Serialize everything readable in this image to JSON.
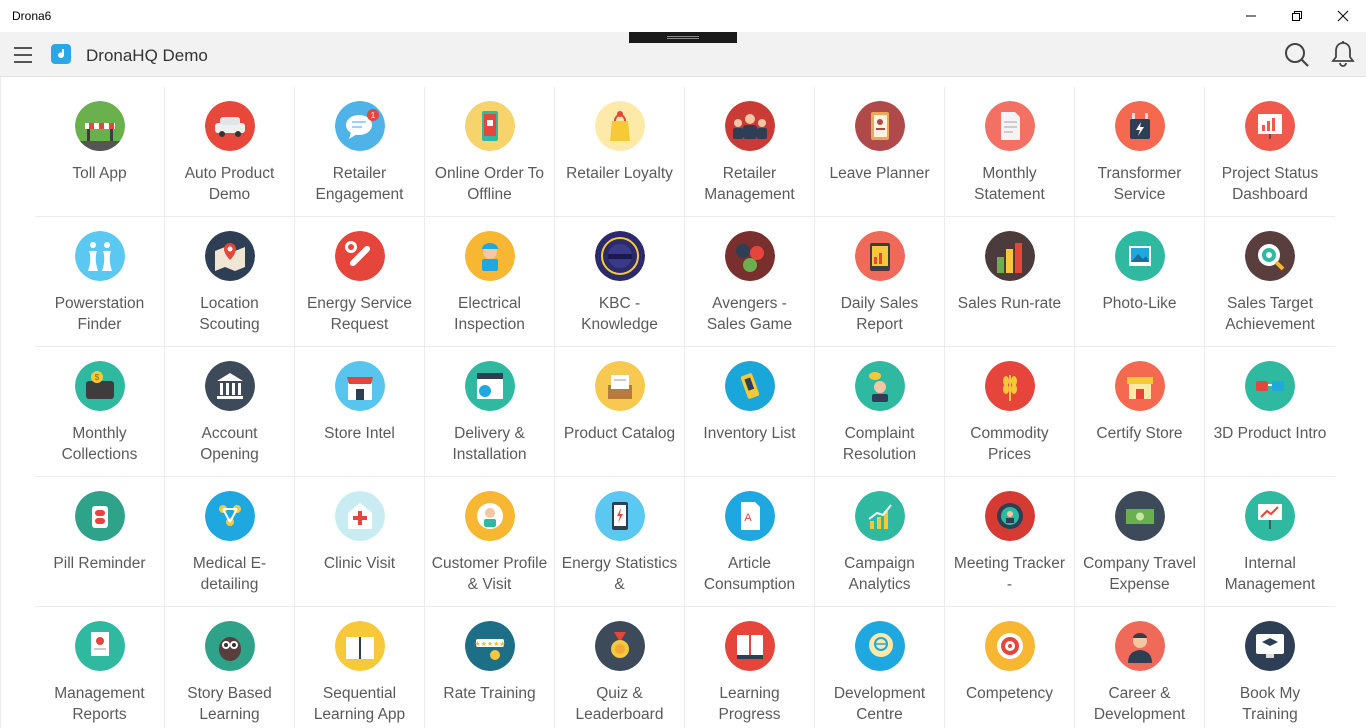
{
  "window": {
    "title": "Drona6",
    "buttons": {
      "minimize": "minimize",
      "maximize": "maximize",
      "close": "close"
    }
  },
  "appbar": {
    "title": "DronaHQ Demo",
    "brand_color": "#29a7e8",
    "icons": [
      "hamburger-menu-icon",
      "app-logo-icon",
      "search-icon",
      "bell-icon"
    ]
  },
  "apps": [
    {
      "label": "Toll App",
      "bg": "#6ab04c",
      "icon": "toll-barrier-icon"
    },
    {
      "label": "Auto Product Demo",
      "bg": "#e8473b",
      "icon": "car-icon"
    },
    {
      "label": "Retailer Engagement",
      "bg": "#4fb3e8",
      "icon": "chat-bubble-icon"
    },
    {
      "label": "Online Order To Offline",
      "bg": "#f6d36b",
      "icon": "mobile-cart-icon"
    },
    {
      "label": "Retailer Loyalty",
      "bg": "#fde9a8",
      "icon": "shopping-bag-icon"
    },
    {
      "label": "Retailer Management",
      "bg": "#c93b34",
      "icon": "people-group-icon"
    },
    {
      "label": "Leave Planner",
      "bg": "#b04a4a",
      "icon": "notebook-icon"
    },
    {
      "label": "Monthly Statement",
      "bg": "#f27164",
      "icon": "document-icon"
    },
    {
      "label": "Transformer Service",
      "bg": "#f4694f",
      "icon": "transformer-icon"
    },
    {
      "label": "Project Status Dashboard",
      "bg": "#ef5a4d",
      "icon": "dashboard-chart-icon"
    },
    {
      "label": "Powerstation Finder",
      "bg": "#5ac8f0",
      "icon": "cooling-tower-icon"
    },
    {
      "label": "Location Scouting",
      "bg": "#2e3e55",
      "icon": "map-pin-icon"
    },
    {
      "label": "Energy Service Request",
      "bg": "#e5453a",
      "icon": "wrench-icon"
    },
    {
      "label": "Electrical Inspection",
      "bg": "#f7b733",
      "icon": "worker-icon"
    },
    {
      "label": "KBC - Knowledge",
      "bg": "#2b2a6a",
      "icon": "kbc-logo-icon"
    },
    {
      "label": "Avengers - Sales Game",
      "bg": "#7a2f2f",
      "icon": "avengers-icon"
    },
    {
      "label": "Daily Sales Report",
      "bg": "#f06a5a",
      "icon": "tablet-chart-icon"
    },
    {
      "label": "Sales Run-rate",
      "bg": "#4b3b3b",
      "icon": "bar-columns-icon"
    },
    {
      "label": "Photo-Like",
      "bg": "#2fb9a0",
      "icon": "photo-icon"
    },
    {
      "label": "Sales Target Achievement",
      "bg": "#5a3d3d",
      "icon": "target-magnifier-icon"
    },
    {
      "label": "Monthly Collections",
      "bg": "#2fb9a0",
      "icon": "wallet-coins-icon"
    },
    {
      "label": "Account Opening",
      "bg": "#3d4a5a",
      "icon": "bank-icon"
    },
    {
      "label": "Store Intel",
      "bg": "#58c5ee",
      "icon": "storefront-icon"
    },
    {
      "label": "Delivery & Installation",
      "bg": "#2fb9a0",
      "icon": "calendar-grid-icon"
    },
    {
      "label": "Product Catalog",
      "bg": "#f7c950",
      "icon": "catalog-box-icon"
    },
    {
      "label": "Inventory List",
      "bg": "#1aa6d8",
      "icon": "inventory-phone-icon"
    },
    {
      "label": "Complaint Resolution",
      "bg": "#2fb9a0",
      "icon": "support-agent-icon"
    },
    {
      "label": "Commodity Prices",
      "bg": "#e5453a",
      "icon": "wheat-icon"
    },
    {
      "label": "Certify Store",
      "bg": "#f4694f",
      "icon": "shop-awning-icon"
    },
    {
      "label": "3D Product Intro",
      "bg": "#2fb9a0",
      "icon": "3d-glasses-icon"
    },
    {
      "label": "Pill Reminder",
      "bg": "#2fa38a",
      "icon": "pill-icon"
    },
    {
      "label": "Medical E-detailing",
      "bg": "#1fa8e0",
      "icon": "molecule-icon"
    },
    {
      "label": "Clinic Visit",
      "bg": "#c8ecf2",
      "icon": "clinic-cross-icon"
    },
    {
      "label": "Customer Profile & Visit",
      "bg": "#f7b733",
      "icon": "customer-profile-icon"
    },
    {
      "label": "Energy Statistics &",
      "bg": "#5ac8f0",
      "icon": "phone-energy-icon"
    },
    {
      "label": "Article Consumption",
      "bg": "#1fa8e0",
      "icon": "article-icon"
    },
    {
      "label": "Campaign Analytics",
      "bg": "#2fb9a0",
      "icon": "growth-chart-icon"
    },
    {
      "label": "Meeting Tracker -",
      "bg": "#d63b33",
      "icon": "meeting-target-icon"
    },
    {
      "label": "Company Travel Expense",
      "bg": "#3d4a5a",
      "icon": "cash-icon"
    },
    {
      "label": "Internal Management",
      "bg": "#2fb9a0",
      "icon": "presentation-icon"
    },
    {
      "label": "Management Reports",
      "bg": "#2fb9a0",
      "icon": "report-hand-icon"
    },
    {
      "label": "Story Based Learning",
      "bg": "#2fa38a",
      "icon": "owl-icon"
    },
    {
      "label": "Sequential Learning App",
      "bg": "#f7c93a",
      "icon": "open-book-icon"
    },
    {
      "label": "Rate Training",
      "bg": "#1c6f86",
      "icon": "star-rating-icon"
    },
    {
      "label": "Quiz & Leaderboard",
      "bg": "#3d4a5a",
      "icon": "medal-icon"
    },
    {
      "label": "Learning Progress",
      "bg": "#e5453a",
      "icon": "book-stack-icon"
    },
    {
      "label": "Development Centre",
      "bg": "#1fa8e0",
      "icon": "head-globe-icon"
    },
    {
      "label": "Competency",
      "bg": "#f7b733",
      "icon": "bullseye-icon"
    },
    {
      "label": "Career & Development",
      "bg": "#f06a5a",
      "icon": "businessman-icon"
    },
    {
      "label": "Book My Training",
      "bg": "#2e3e55",
      "icon": "online-training-icon"
    }
  ]
}
